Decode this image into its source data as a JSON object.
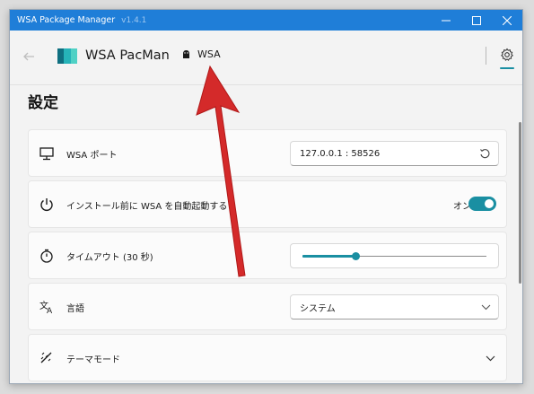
{
  "window": {
    "title": "WSA Package Manager",
    "version": "v1.4.1"
  },
  "appbar": {
    "app_name": "WSA PacMan",
    "tab_label": "WSA"
  },
  "page": {
    "title": "設定"
  },
  "settings": [
    {
      "label": "WSA ポート",
      "icon": "monitor-icon",
      "value": "127.0.0.1 :  58526"
    },
    {
      "label": "インストール前に WSA を自動起動する",
      "icon": "power-icon",
      "toggle_label": "オン",
      "toggle_on": true
    },
    {
      "label": "タイムアウト (30 秒)",
      "icon": "stopwatch-icon",
      "slider_fraction": 0.29
    },
    {
      "label": "言語",
      "icon": "translate-icon",
      "value": "システム"
    },
    {
      "label": "テーマモード",
      "icon": "theme-icon"
    }
  ],
  "colors": {
    "titlebar": "#1f7ed8",
    "accent": "#1a8fa2",
    "annotation_arrow": "#d42a2a"
  }
}
